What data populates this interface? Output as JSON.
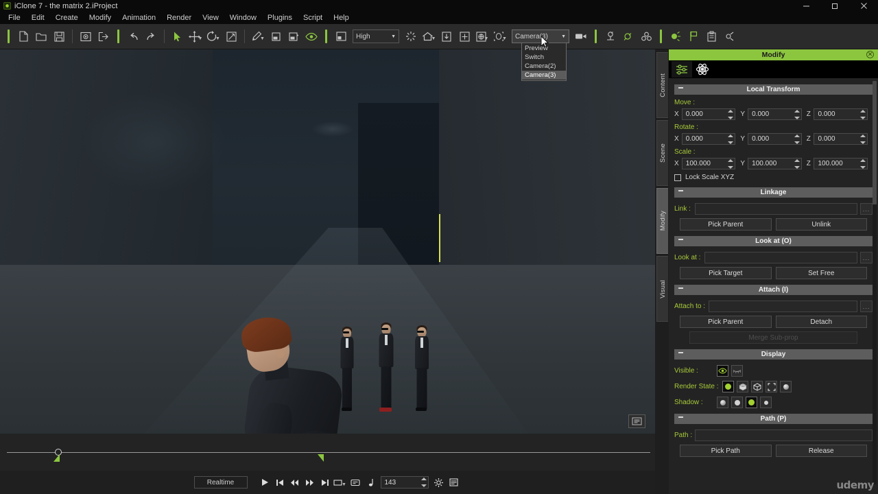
{
  "window": {
    "title": "iClone 7 - the matrix 2.iProject",
    "app_icon": "iclone-logo-icon",
    "controls": {
      "minimize": "–",
      "restore": "❐",
      "close": "✕"
    }
  },
  "menu": {
    "items": [
      "File",
      "Edit",
      "Create",
      "Modify",
      "Animation",
      "Render",
      "View",
      "Window",
      "Plugins",
      "Script",
      "Help"
    ]
  },
  "toolbar": {
    "groups": [
      {
        "icons": [
          "new-project-icon",
          "open-project-icon",
          "save-project-icon"
        ]
      },
      {
        "icons": [
          "import-icon",
          "export-icon"
        ]
      },
      {
        "icons": [
          "undo-icon",
          "redo-icon"
        ]
      },
      {
        "icons": [
          "select-tool-icon",
          "move-tool-icon",
          "rotate-tool-icon",
          "scale-tool-icon"
        ]
      },
      {
        "icons": [
          "edit-motion-icon",
          "align-left-icon",
          "align-right-icon",
          "preview-eye-icon"
        ]
      }
    ],
    "render_quality": {
      "label": "High",
      "options": [
        "High"
      ]
    },
    "icons_right": [
      "viewport-layout-icon",
      "light-icon",
      "home-view-icon",
      "down-view-icon",
      "frame-all-icon",
      "globe-icon",
      "gizmo-icon"
    ],
    "camera_select": {
      "label": "Camera(3)",
      "options": [
        "Preview",
        "Switch",
        "Camera(2)",
        "Camera(3)"
      ],
      "selected": "Camera(3)"
    },
    "camera_icon": "video-camera-icon",
    "tail_icons": [
      "physics-icon",
      "soft-cloth-icon",
      "particle-icon",
      "light-set-icon",
      "flag-icon",
      "props-icon",
      "spring-icon"
    ]
  },
  "viewport": {
    "corner_button": "viewport-display-icon"
  },
  "timeline": {
    "playhead_label": "",
    "marker_left": "range-start-marker",
    "marker_right": "range-end-marker"
  },
  "transport": {
    "mode": "Realtime",
    "buttons": [
      "play-button",
      "jump-start-button",
      "step-back-button",
      "step-forward-button",
      "jump-end-button",
      "range-button",
      "subtitle-button",
      "note-button"
    ],
    "frame_value": "143",
    "settings_icon": "gear-icon",
    "timeline_icon": "timeline-icon"
  },
  "right_panel": {
    "title": "Modify",
    "close_icon": "✕",
    "vertical_tabs": [
      {
        "label": "Content",
        "selected": false
      },
      {
        "label": "Scene",
        "selected": false
      },
      {
        "label": "Modify",
        "selected": true
      },
      {
        "label": "Visual",
        "selected": false
      }
    ],
    "panel_tabs": [
      "attribute-sliders-icon",
      "physics-atom-icon"
    ],
    "sections": {
      "local_transform": {
        "title": "Local Transform",
        "move": {
          "label": "Move :",
          "x": "0.000",
          "y": "0.000",
          "z": "0.000"
        },
        "rotate": {
          "label": "Rotate :",
          "x": "0.000",
          "y": "0.000",
          "z": "0.000"
        },
        "scale": {
          "label": "Scale :",
          "x": "100.000",
          "y": "100.000",
          "z": "100.000"
        },
        "lock_scale": {
          "label": "Lock Scale XYZ",
          "checked": false
        }
      },
      "linkage": {
        "title": "Linkage",
        "link_label": "Link :",
        "link_value": "",
        "pick_parent": "Pick Parent",
        "unlink": "Unlink"
      },
      "look_at": {
        "title": "Look at  (O)",
        "field_label": "Look at :",
        "field_value": "",
        "pick_target": "Pick Target",
        "set_free": "Set Free"
      },
      "attach": {
        "title": "Attach  (I)",
        "field_label": "Attach to :",
        "field_value": "",
        "pick_parent": "Pick Parent",
        "detach": "Detach",
        "merge_sub_prop": "Merge Sub-prop"
      },
      "display": {
        "title": "Display",
        "visible": {
          "label": "Visible :",
          "options": [
            "visible-eye-icon",
            "hidden-eye-icon"
          ],
          "selected_index": 0
        },
        "render_state": {
          "label": "Render State :",
          "options": [
            "solid-icon",
            "box-icon",
            "wireframe-icon",
            "bounding-icon",
            "shaded-icon"
          ],
          "selected_index": 0
        },
        "shadow": {
          "label": "Shadow :",
          "options": [
            "shadow-full-icon",
            "shadow-soft-icon",
            "shadow-on-icon",
            "shadow-off-icon"
          ],
          "selected_index": 2
        }
      },
      "path": {
        "title": "Path  (P)",
        "field_label": "Path :",
        "field_value": "",
        "pick_path": "Pick Path",
        "release": "Release"
      }
    },
    "watermark": "udemy"
  },
  "colors": {
    "accent_green": "#8cc63f",
    "label_green": "#a7c93a",
    "panel_bg": "#232323",
    "viewport_bg": "#272c31",
    "selection_line": "#d9e04a"
  }
}
